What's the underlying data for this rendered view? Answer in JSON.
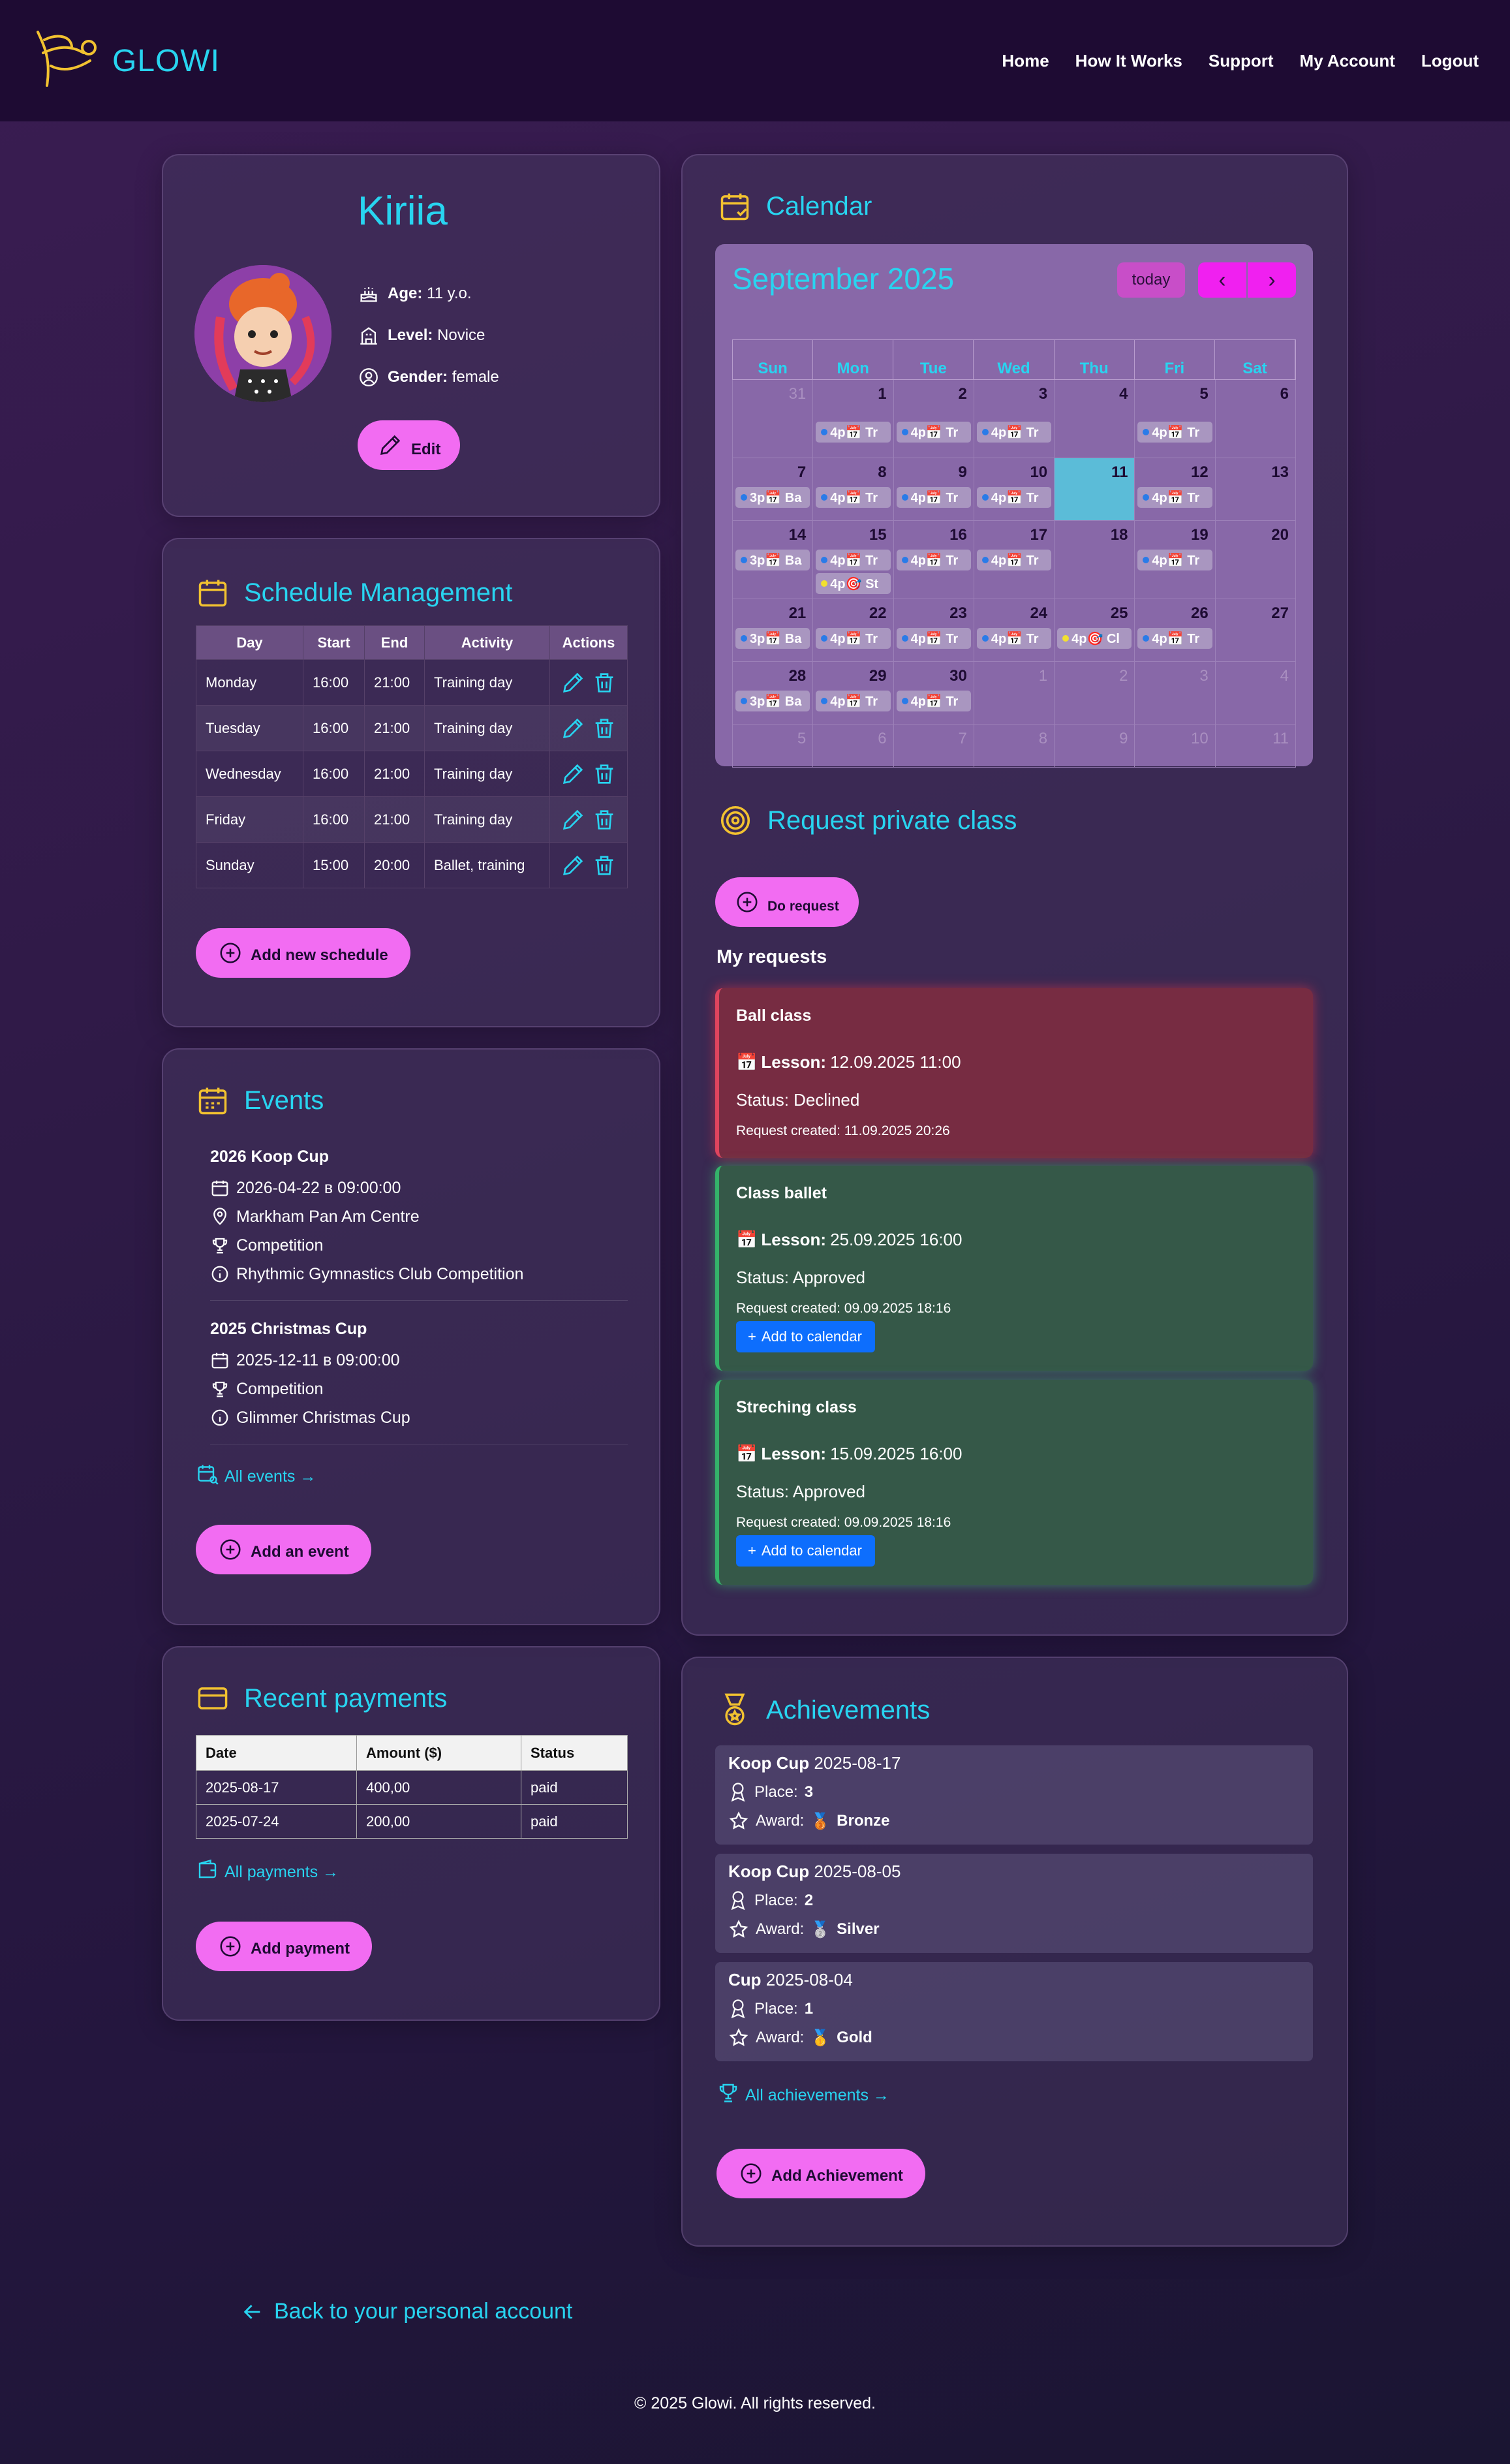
{
  "nav": {
    "brand": "GLOWI",
    "links": [
      "Home",
      "How It Works",
      "Support",
      "My Account",
      "Logout"
    ]
  },
  "profile": {
    "name": "Kiriia",
    "age_label": "Age:",
    "age_value": "11 y.o.",
    "level_label": "Level:",
    "level_value": "Novice",
    "gender_label": "Gender:",
    "gender_value": "female",
    "edit_label": "Edit"
  },
  "schedule": {
    "title": "Schedule Management",
    "columns": [
      "Day",
      "Start",
      "End",
      "Activity",
      "Actions"
    ],
    "rows": [
      {
        "day": "Monday",
        "start": "16:00",
        "end": "21:00",
        "activity": "Training day"
      },
      {
        "day": "Tuesday",
        "start": "16:00",
        "end": "21:00",
        "activity": "Training day"
      },
      {
        "day": "Wednesday",
        "start": "16:00",
        "end": "21:00",
        "activity": "Training day"
      },
      {
        "day": "Friday",
        "start": "16:00",
        "end": "21:00",
        "activity": "Training day"
      },
      {
        "day": "Sunday",
        "start": "15:00",
        "end": "20:00",
        "activity": "Ballet, training"
      }
    ],
    "add_label": "Add new schedule"
  },
  "events": {
    "title": "Events",
    "items": [
      {
        "name": "2026 Koop Cup",
        "date": "2026-04-22 в 09:00:00",
        "location": "Markham Pan Am Centre",
        "type": "Competition",
        "description": "Rhythmic Gymnastics Club Competition"
      },
      {
        "name": "2025 Christmas Cup",
        "date": "2025-12-11 в 09:00:00",
        "type": "Competition",
        "description": "Glimmer Christmas Cup"
      }
    ],
    "all_label": "All events →",
    "add_label": "Add an event"
  },
  "payments": {
    "title": "Recent payments",
    "columns": [
      "Date",
      "Amount ($)",
      "Status"
    ],
    "rows": [
      {
        "date": "2025-08-17",
        "amount": "400,00",
        "status": "paid"
      },
      {
        "date": "2025-07-24",
        "amount": "200,00",
        "status": "paid"
      }
    ],
    "all_label": "All payments →",
    "add_label": "Add payment"
  },
  "calendar": {
    "title": "Calendar",
    "month": "September 2025",
    "today_label": "today",
    "prev_icon": "‹",
    "next_icon": "›",
    "weekdays": [
      "Sun",
      "Mon",
      "Tue",
      "Wed",
      "Thu",
      "Fri",
      "Sat"
    ],
    "weeks": [
      [
        {
          "d": "31",
          "o": true
        },
        {
          "d": "1",
          "e": [
            "b:4p📅 Tr"
          ]
        },
        {
          "d": "2",
          "e": [
            "b:4p📅 Tr"
          ]
        },
        {
          "d": "3",
          "e": [
            "b:4p📅 Tr"
          ]
        },
        {
          "d": "4"
        },
        {
          "d": "5",
          "e": [
            "b:4p📅 Tr"
          ]
        },
        {
          "d": "6"
        }
      ],
      [
        {
          "d": "7",
          "e": [
            "b:3p📅 Ba"
          ]
        },
        {
          "d": "8",
          "e": [
            "b:4p📅 Tr"
          ]
        },
        {
          "d": "9",
          "e": [
            "b:4p📅 Tr"
          ]
        },
        {
          "d": "10",
          "e": [
            "b:4p📅 Tr"
          ]
        },
        {
          "d": "11",
          "t": true
        },
        {
          "d": "12",
          "e": [
            "b:4p📅 Tr"
          ]
        },
        {
          "d": "13"
        }
      ],
      [
        {
          "d": "14",
          "e": [
            "b:3p📅 Ba"
          ]
        },
        {
          "d": "15",
          "e": [
            "b:4p📅 Tr",
            "y:4p🎯 St"
          ]
        },
        {
          "d": "16",
          "e": [
            "b:4p📅 Tr"
          ]
        },
        {
          "d": "17",
          "e": [
            "b:4p📅 Tr"
          ]
        },
        {
          "d": "18"
        },
        {
          "d": "19",
          "e": [
            "b:4p📅 Tr"
          ]
        },
        {
          "d": "20"
        }
      ],
      [
        {
          "d": "21",
          "e": [
            "b:3p📅 Ba"
          ]
        },
        {
          "d": "22",
          "e": [
            "b:4p📅 Tr"
          ]
        },
        {
          "d": "23",
          "e": [
            "b:4p📅 Tr"
          ]
        },
        {
          "d": "24",
          "e": [
            "b:4p📅 Tr"
          ]
        },
        {
          "d": "25",
          "e": [
            "y:4p🎯 Cl"
          ]
        },
        {
          "d": "26",
          "e": [
            "b:4p📅 Tr"
          ]
        },
        {
          "d": "27"
        }
      ],
      [
        {
          "d": "28",
          "e": [
            "b:3p📅 Ba"
          ]
        },
        {
          "d": "29",
          "e": [
            "b:4p📅 Tr"
          ]
        },
        {
          "d": "30",
          "e": [
            "b:4p📅 Tr"
          ]
        },
        {
          "d": "1",
          "o": true
        },
        {
          "d": "2",
          "o": true
        },
        {
          "d": "3",
          "o": true
        },
        {
          "d": "4",
          "o": true
        }
      ],
      [
        {
          "d": "5",
          "o": true
        },
        {
          "d": "6",
          "o": true
        },
        {
          "d": "7",
          "o": true
        },
        {
          "d": "8",
          "o": true
        },
        {
          "d": "9",
          "o": true
        },
        {
          "d": "10",
          "o": true
        },
        {
          "d": "11",
          "o": true
        }
      ]
    ]
  },
  "requests": {
    "title": "Request private class",
    "do_label": "Do request",
    "my_label": "My requests",
    "lesson_label": "Lesson:",
    "add_cal_label": "Add to calendar",
    "items": [
      {
        "name": "Ball class",
        "lesson": "12.09.2025 11:00",
        "status": "Status: Declined",
        "created": "Request created: 11.09.2025 20:26"
      },
      {
        "name": "Class ballet",
        "lesson": "25.09.2025 16:00",
        "status": "Status: Approved",
        "created": "Request created: 09.09.2025 18:16"
      },
      {
        "name": "Streching class",
        "lesson": "15.09.2025 16:00",
        "status": "Status: Approved",
        "created": "Request created: 09.09.2025 18:16"
      }
    ]
  },
  "achievements": {
    "title": "Achievements",
    "place_label": "Place:",
    "award_label": "Award:",
    "items": [
      {
        "event": "Koop Cup",
        "date": "2025-08-17",
        "place": "3",
        "medal": "🥉",
        "award": "Bronze"
      },
      {
        "event": "Koop Cup",
        "date": "2025-08-05",
        "place": "2",
        "medal": "🥈",
        "award": "Silver"
      },
      {
        "event": "Cup",
        "date": "2025-08-04",
        "place": "1",
        "medal": "🥇",
        "award": "Gold"
      }
    ],
    "all_label": "All achievements →",
    "add_label": "Add Achievement"
  },
  "back_label": "Back to your personal account",
  "footer": "© 2025 Glowi. All rights reserved.",
  "colors": {
    "accent": "#28d4f0",
    "pink": "#f26cf2",
    "icon_yellow": "#f2c230"
  }
}
